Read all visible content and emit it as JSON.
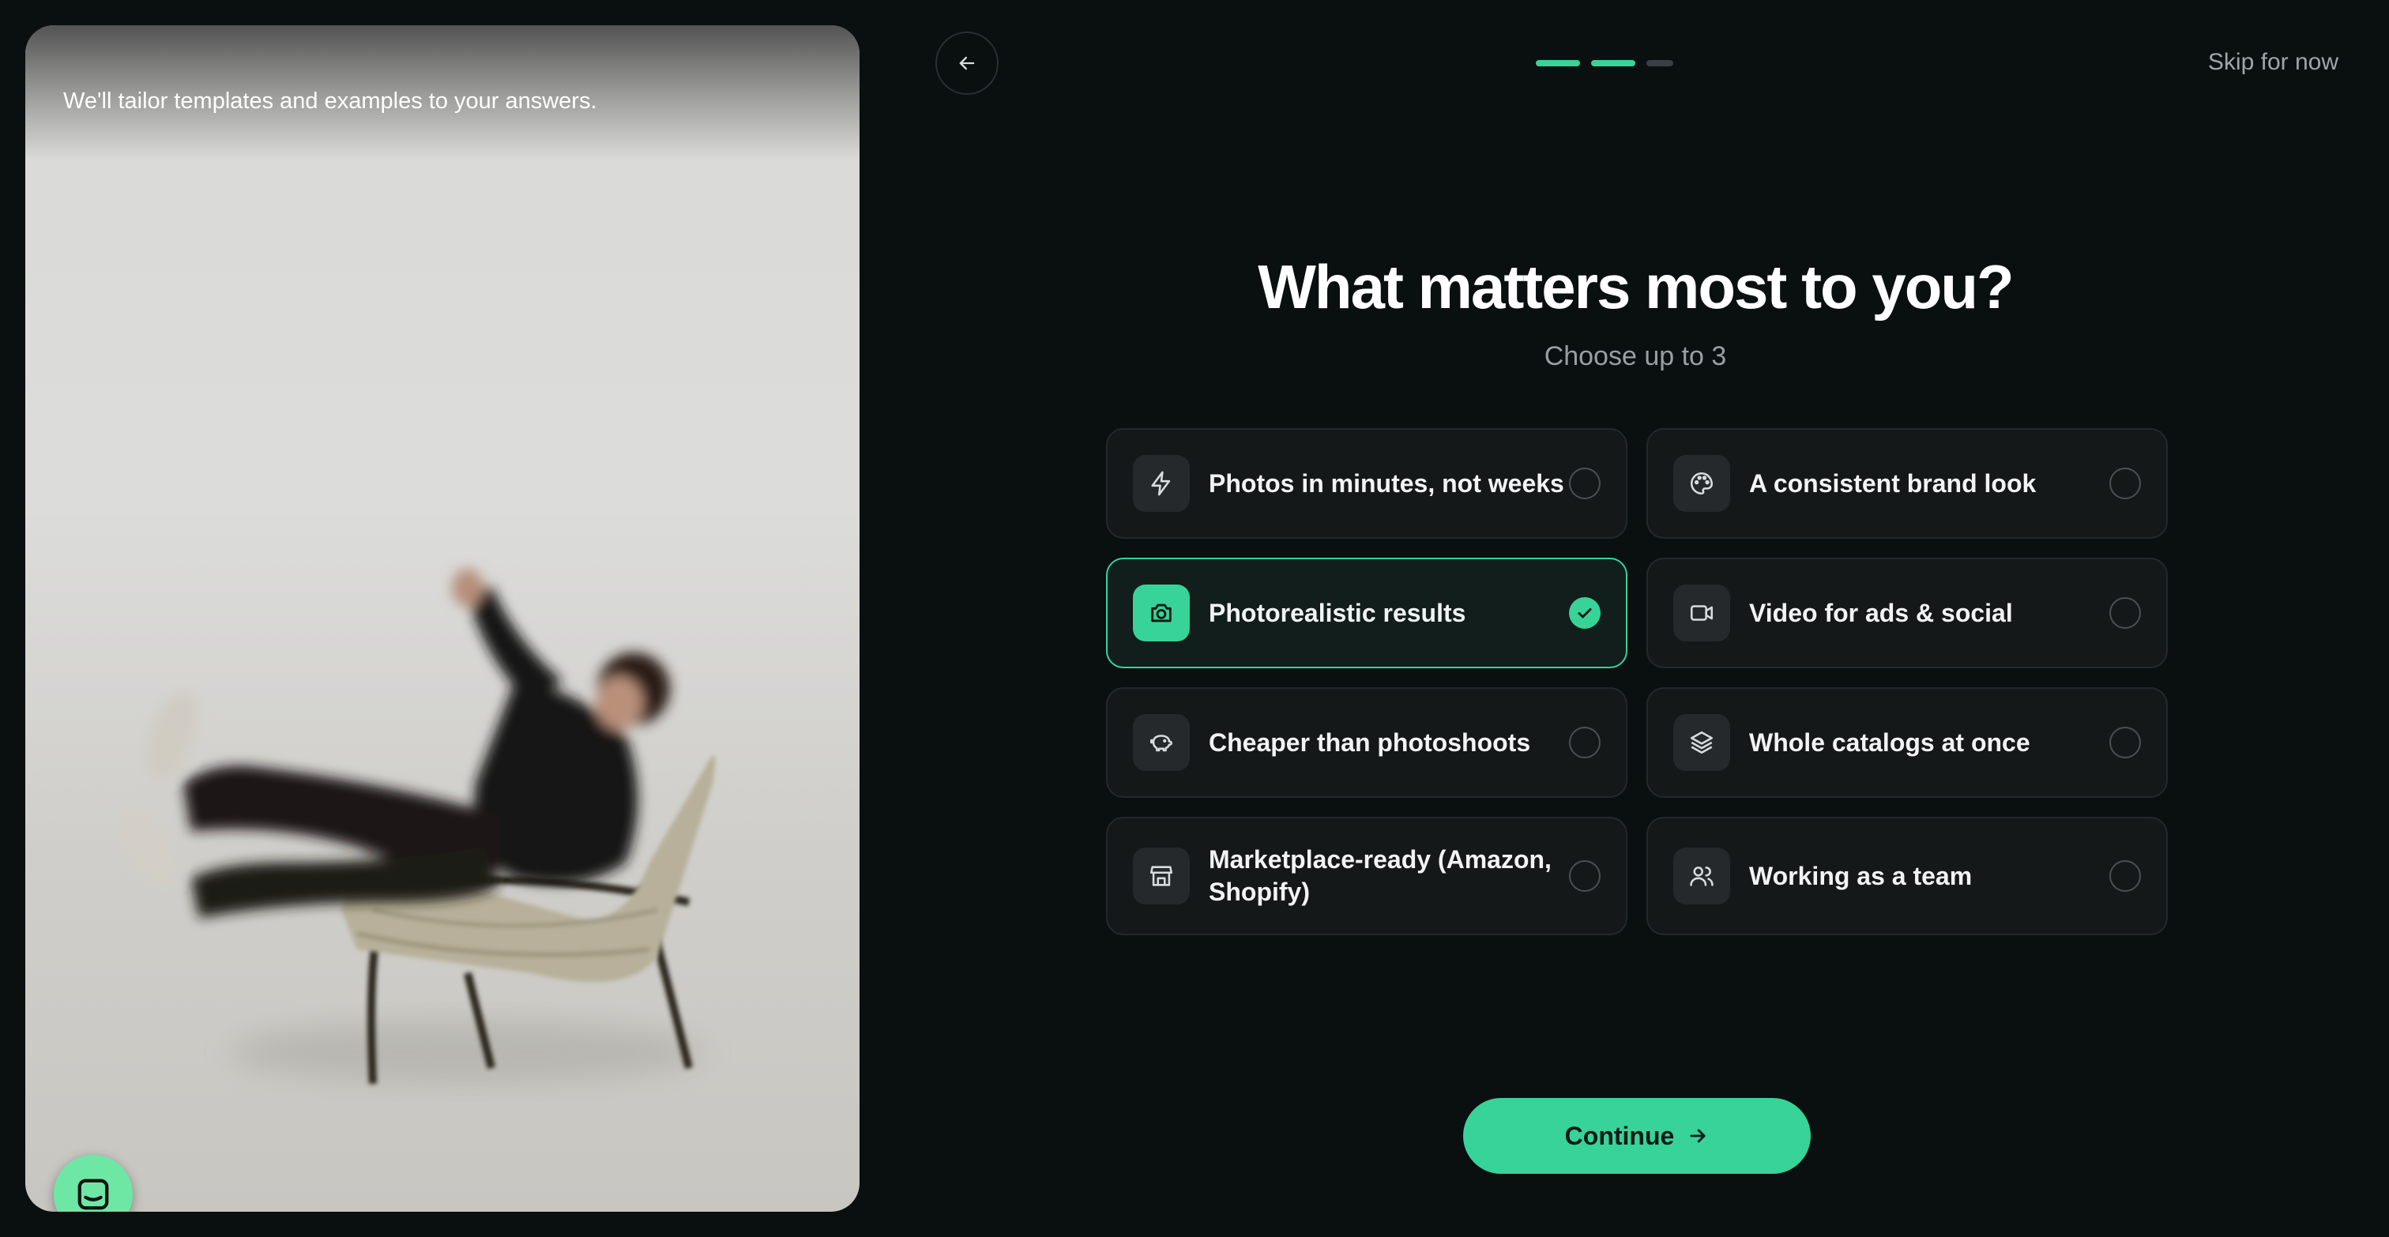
{
  "left_panel": {
    "caption": "We'll tailor templates and examples to your answers."
  },
  "header": {
    "back_icon": "arrow-left-icon",
    "progress": {
      "total_steps": 3,
      "completed_steps": 2
    },
    "skip_label": "Skip for now"
  },
  "question": {
    "title": "What matters most to you?",
    "subtitle": "Choose up to 3"
  },
  "options": [
    {
      "label": "Photos in minutes, not weeks",
      "icon": "lightning-icon",
      "selected": false
    },
    {
      "label": "A consistent brand look",
      "icon": "palette-icon",
      "selected": false
    },
    {
      "label": "Photorealistic results",
      "icon": "camera-icon",
      "selected": true
    },
    {
      "label": "Video for ads & social",
      "icon": "video-icon",
      "selected": false
    },
    {
      "label": "Cheaper than photoshoots",
      "icon": "piggy-bank-icon",
      "selected": false
    },
    {
      "label": "Whole catalogs at once",
      "icon": "layers-icon",
      "selected": false
    },
    {
      "label": "Marketplace-ready (Amazon, Shopify)",
      "icon": "store-icon",
      "selected": false
    },
    {
      "label": "Working as a team",
      "icon": "users-icon",
      "selected": false
    }
  ],
  "continue_label": "Continue",
  "chat_icon": "chat-icon",
  "colors": {
    "background": "#0a0f10",
    "accent": "#37d399",
    "card": "#141819",
    "muted_text": "#9aa0a2"
  }
}
